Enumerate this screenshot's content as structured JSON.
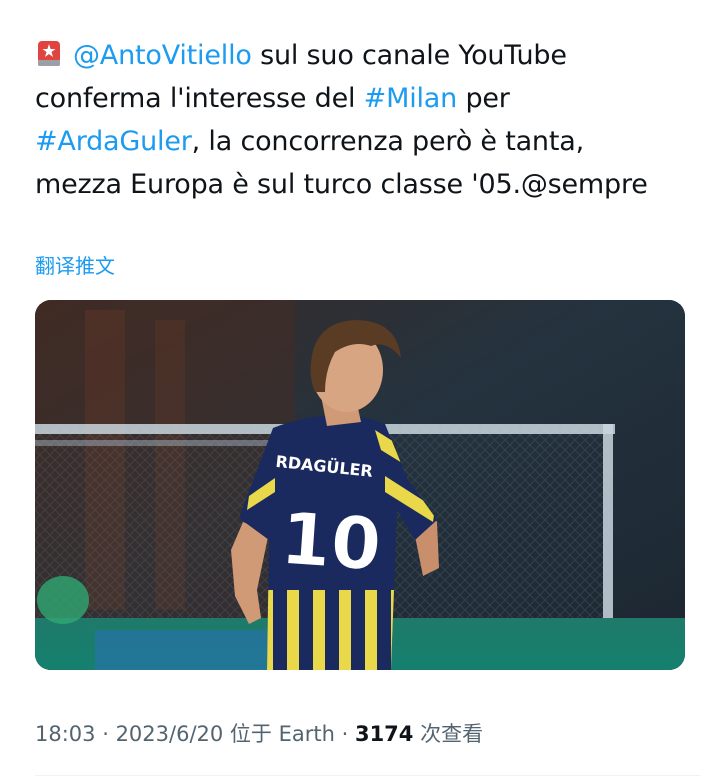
{
  "tweet": {
    "icon": "police-siren-icon",
    "mention": "@AntoVitiello",
    "line1_rest": " sul suo canale YouTube",
    "line2_pre": "conferma l'interesse del ",
    "hashtag_milan": "#Milan",
    "line2_post": " per",
    "hashtag_arda": "#ArdaGuler",
    "line3_post": ", la concorrenza però è tanta,",
    "line4_pre": "mezza Europa è sul turco classe '05.",
    "line4_mention": "@sempre"
  },
  "translate_label": "翻译推文",
  "media": {
    "jersey_name": "RDAGÜLER",
    "jersey_number": "10",
    "colors": {
      "navy": "#1b2a5e",
      "yellow": "#e8d84a"
    }
  },
  "meta": {
    "time": "18:03",
    "sep1": " · ",
    "date": "2023/6/20",
    "location": " 位于 Earth",
    "sep2": " · ",
    "views": "3174",
    "views_label": " 次查看"
  }
}
